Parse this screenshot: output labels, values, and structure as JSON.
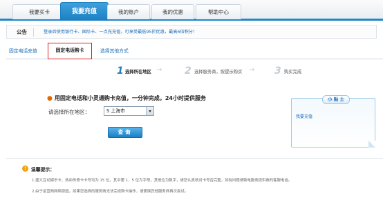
{
  "nav": {
    "tabs": [
      "我要买卡",
      "我要充值",
      "我的账户",
      "我的优惠",
      "帮助中心"
    ],
    "active_index": 1
  },
  "notice": {
    "label": "公告",
    "text": "登录后使用银行卡、国际卡、一点充充值，可享受最低95折优惠，最高6倍积分！"
  },
  "subtabs": {
    "items": [
      "固定电话充值",
      "固定电话购卡",
      "选择其他方式"
    ],
    "active_index": 1
  },
  "steps": [
    {
      "num": "1",
      "label": "选择所在地区"
    },
    {
      "num": "2",
      "label": "选择服务商，按提示购买"
    },
    {
      "num": "3",
      "label": "购买完成"
    }
  ],
  "form": {
    "headline": "用固定电话和小灵通购卡充值，一分钟完成，24小时提供服务",
    "region_label": "请选择所在地区：",
    "region_value": "S 上海市",
    "query_button": "查询"
  },
  "tips_box": {
    "title": "小 贴 士",
    "link": "我要充值"
  },
  "warm_tips": {
    "title": "温馨提示：",
    "lines": [
      "1.盛大互动娱乐卡、热血传奇卡卡号均为 15 位，其中第 1、5 位为字母，其他位为数字，请您认真核对卡号否完整，如有问题请致电服务提供商的客服电话。",
      "2.由于运营商网络原因，如果您选择的服务商无法完成购卡操作，请更换其他服务商再次尝试。"
    ]
  },
  "colors": {
    "accent": "#1a7fc2",
    "link": "#1a6cb8",
    "highlight_border": "#d62020",
    "bullet": "#e06a00",
    "warning": "#f2a10c"
  }
}
